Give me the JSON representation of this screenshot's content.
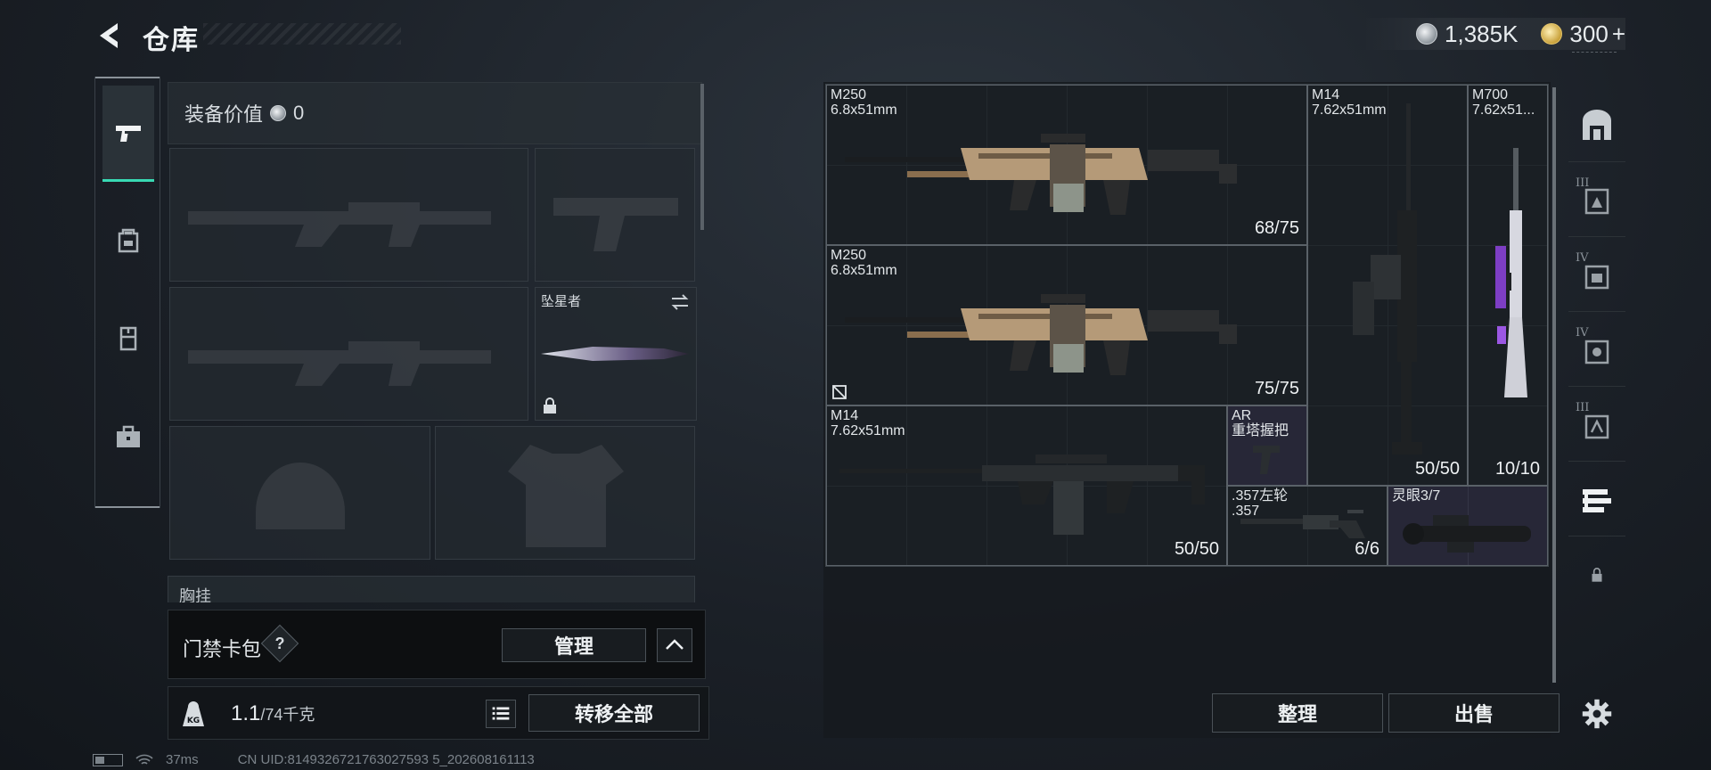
{
  "header": {
    "title": "仓库",
    "silver": "1,385K",
    "gold": "300",
    "plus": "+",
    "back_icon": "back-arrow-icon"
  },
  "left_nav": [
    "pistol-icon",
    "backpack-icon",
    "vest-icon",
    "case-icon"
  ],
  "equipment": {
    "value_label": "装备价值",
    "value": "0",
    "melee_name": "坠星者",
    "chest_label": "胸挂"
  },
  "keycard": {
    "label": "门禁卡包",
    "help": "?",
    "manage": "管理"
  },
  "weight": {
    "current": "1.1",
    "max": "/74千克",
    "transfer_all": "转移全部"
  },
  "status": {
    "ping": "37ms",
    "uid": "CN UID:8149326721763027593 5_202608161113"
  },
  "stash": {
    "items": [
      {
        "name": "M250",
        "ammo": "6.8x51mm",
        "count": "68/75"
      },
      {
        "name": "M250",
        "ammo": "6.8x51mm",
        "count": "75/75"
      },
      {
        "name": "M14",
        "ammo": "7.62x51mm",
        "count": "50/50"
      },
      {
        "name": "M700",
        "ammo": "7.62x51...",
        "count": "10/10"
      },
      {
        "name": "M14",
        "ammo": "7.62x51mm",
        "count": "50/50"
      },
      {
        "name": "AR",
        "ammo": "重塔握把",
        "count": ""
      },
      {
        "name": ".357左轮",
        "ammo": ".357",
        "count": "6/6"
      },
      {
        "name": "灵眼3/7",
        "ammo": "",
        "count": ""
      }
    ],
    "sort": "整理",
    "sell": "出售"
  },
  "right_nav": [
    {
      "icon": "vault-icon",
      "label": ""
    },
    {
      "icon": "tier-3-armor-icon",
      "label": "III"
    },
    {
      "icon": "tier-4-folder-icon",
      "label": "IV"
    },
    {
      "icon": "tier-4-armor-icon",
      "label": "IV"
    },
    {
      "icon": "tier-3-helmet-icon",
      "label": "III"
    },
    {
      "icon": "weapon-rack-icon",
      "label": ""
    },
    {
      "icon": "lock-icon",
      "label": ""
    },
    {
      "icon": "settings-gear-icon",
      "label": ""
    }
  ],
  "colors": {
    "accent": "#38d9b3",
    "panel": "#181c20",
    "purple_item": "#463c64"
  }
}
